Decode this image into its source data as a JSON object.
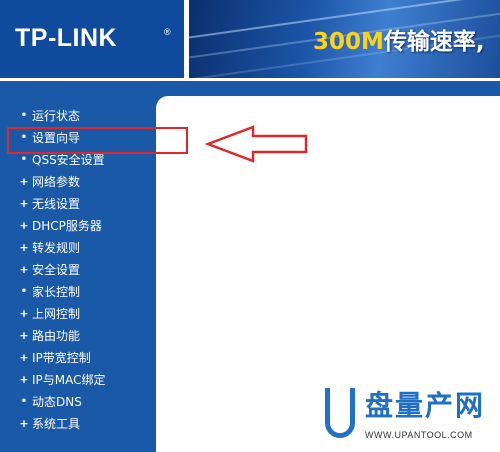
{
  "header": {
    "logo": "TP-LINK",
    "logo_mark": "®",
    "banner_number": "300M",
    "banner_text": "传输速率,"
  },
  "sidebar": {
    "items": [
      {
        "label": "运行状态",
        "marker": "•",
        "icon": "dot-bullet-icon"
      },
      {
        "label": "设置向导",
        "marker": "•",
        "icon": "dot-bullet-icon"
      },
      {
        "label": "QSS安全设置",
        "marker": "•",
        "icon": "dot-bullet-icon"
      },
      {
        "label": "网络参数",
        "marker": "+",
        "icon": "expand-plus-icon"
      },
      {
        "label": "无线设置",
        "marker": "+",
        "icon": "expand-plus-icon"
      },
      {
        "label": "DHCP服务器",
        "marker": "+",
        "icon": "expand-plus-icon"
      },
      {
        "label": "转发规则",
        "marker": "+",
        "icon": "expand-plus-icon"
      },
      {
        "label": "安全设置",
        "marker": "+",
        "icon": "expand-plus-icon"
      },
      {
        "label": "家长控制",
        "marker": "•",
        "icon": "dot-bullet-icon"
      },
      {
        "label": "上网控制",
        "marker": "+",
        "icon": "expand-plus-icon"
      },
      {
        "label": "路由功能",
        "marker": "+",
        "icon": "expand-plus-icon"
      },
      {
        "label": "IP带宽控制",
        "marker": "+",
        "icon": "expand-plus-icon"
      },
      {
        "label": "IP与MAC绑定",
        "marker": "+",
        "icon": "expand-plus-icon"
      },
      {
        "label": "动态DNS",
        "marker": "•",
        "icon": "dot-bullet-icon"
      },
      {
        "label": "系统工具",
        "marker": "+",
        "icon": "expand-plus-icon"
      }
    ]
  },
  "annotation": {
    "highlighted_item": "设置向导",
    "color": "#e0282a"
  },
  "watermark": {
    "title": "盘量产网",
    "url": "WWW.UPANTOOL.COM"
  },
  "colors": {
    "sidebar_bg": "#1a58a8",
    "logo_bg": "#0f4a9d",
    "banner_number": "#ffd21a",
    "watermark_blue": "#1f6fc4"
  }
}
